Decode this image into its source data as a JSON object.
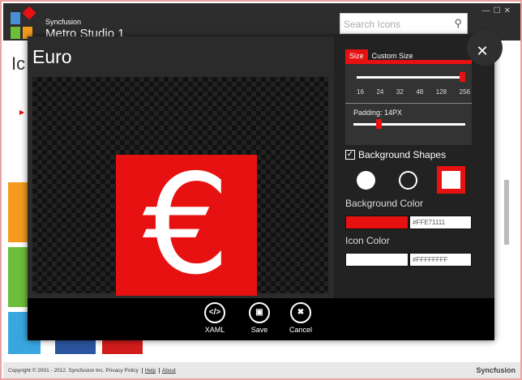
{
  "app": {
    "brand_small": "Syncfusion",
    "brand_big": "Metro Studio 1",
    "search_placeholder": "Search Icons",
    "bg_title": "Ic"
  },
  "dialog": {
    "title": "Euro",
    "icon_glyph": "€",
    "tabs": [
      {
        "label": "Size",
        "active": true
      },
      {
        "label": "Custom Size",
        "active": false
      }
    ],
    "size_ticks": [
      "16",
      "24",
      "32",
      "48",
      "128",
      "256"
    ],
    "size_selected": "256",
    "padding_label": "Padding: 14PX",
    "padding_value": 14,
    "background_shapes_label": "Background Shapes",
    "background_shapes_checked": true,
    "shapes": [
      "filled-circle",
      "outlined-circle",
      "square"
    ],
    "selected_shape": "square",
    "background_color_label": "Background Color",
    "background_color": "#FFE71111",
    "icon_color_label": "Icon Color",
    "icon_color": "#FFFFFFFF",
    "buttons": [
      {
        "label": "XAML",
        "glyph": "</>"
      },
      {
        "label": "Save",
        "glyph": "💾"
      },
      {
        "label": "Cancel",
        "glyph": "✖"
      }
    ]
  },
  "status": {
    "copyright": "Copyright © 2001 - 2012. Syncfusion Inc. Privacy Policy",
    "help": "Help",
    "about": "About",
    "logo": "Syncfusion"
  },
  "colors": {
    "accent": "#e71111",
    "dark": "#2b2b2b"
  }
}
